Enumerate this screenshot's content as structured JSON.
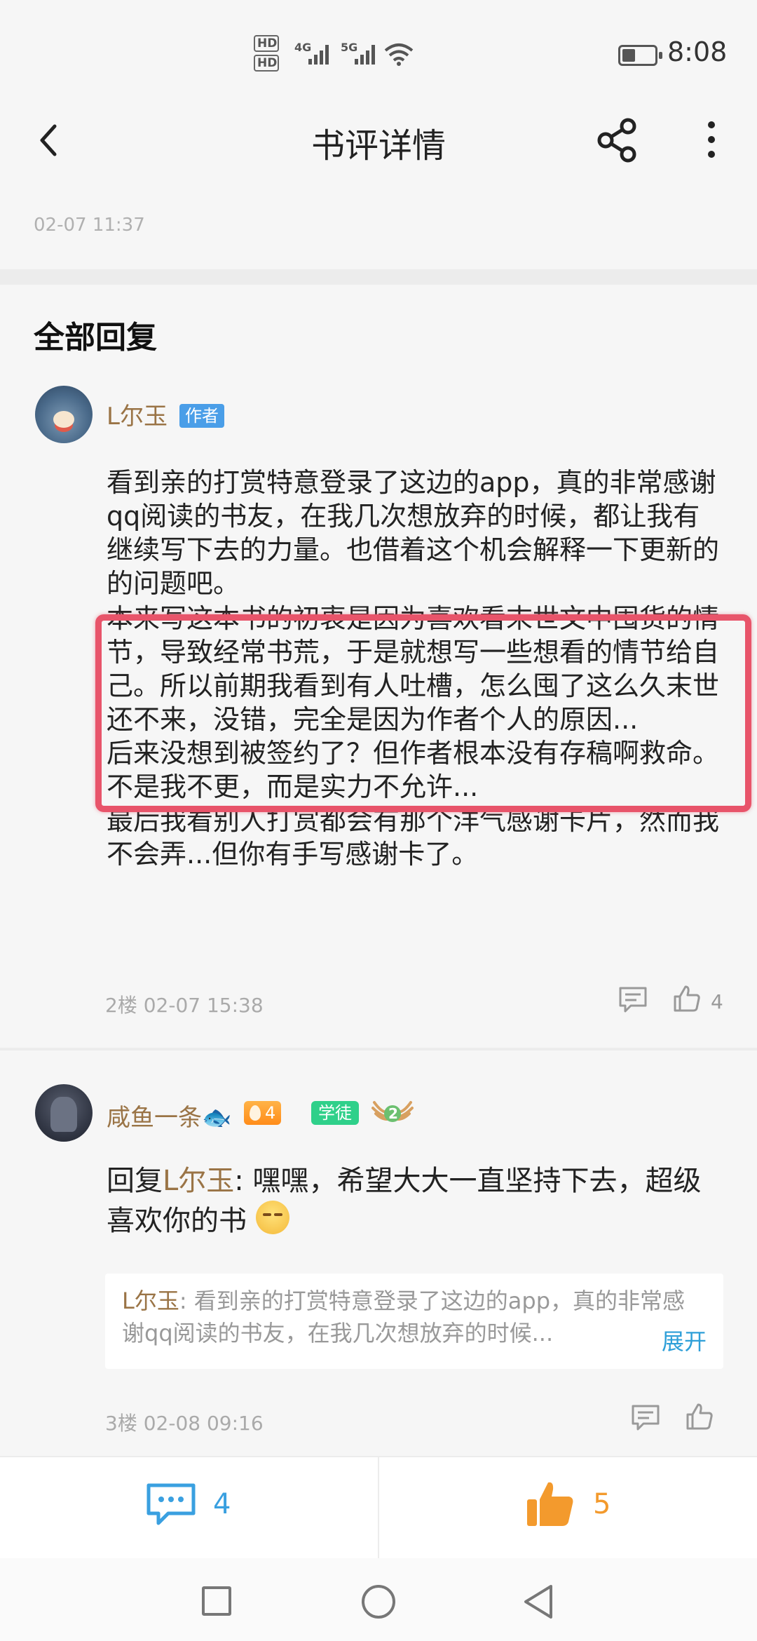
{
  "status_bar": {
    "hd1": "HD",
    "hd2": "HD",
    "network1": "4G",
    "network2": "5G",
    "time": "8:08"
  },
  "header": {
    "title": "书评详情"
  },
  "review": {
    "timestamp": "02-07 11:37"
  },
  "section": {
    "title": "全部回复"
  },
  "comments": [
    {
      "username": "L尔玉",
      "tag": "作者",
      "paragraphs": [
        "看到亲的打赏特意登录了这边的app，真的非常感谢qq阅读的书友，在我几次想放弃的时候，都让我有继续写下去的力量。也借着这个机会解释一下更新的的问题吧。",
        "本来写这本书的初衷是因为喜欢看末世文中囤货的情节，导致经常书荒，于是就想写一些想看的情节给自己。所以前期我看到有人吐槽，怎么囤了这么久末世还不来，没错，完全是因为作者个人的原因...",
        "后来没想到被签约了？但作者根本没有存稿啊救命。不是我不更，而是实力不允许...",
        "最后我看别人打赏都会有那个洋气感谢卡片，然而我不会弄...但你有手写感谢卡了。"
      ],
      "meta": "2楼 02-07 15:38",
      "likes": "4"
    },
    {
      "username": "咸鱼一条🐟",
      "fire_level": "4",
      "badge": "学徒",
      "wing_level": "2",
      "reply_prefix": "回复",
      "reply_to": "L尔玉",
      "reply_body": ": 嘿嘿，希望大大一直坚持下去，超级喜欢你的书",
      "quote_name": "L尔玉",
      "quote_text": ": 看到亲的打赏特意登录了这边的app，真的非常感谢qq阅读的书友，在我几次想放弃的时候...",
      "quote_expand": "展开",
      "meta": "3楼 02-08 09:16"
    }
  ],
  "action_bar": {
    "comment_count": "4",
    "like_count": "5"
  },
  "colors": {
    "username": "#9a7446",
    "highlight": "#e8546a",
    "comment_accent": "#3aa0e0",
    "like_accent": "#f39a2d"
  }
}
